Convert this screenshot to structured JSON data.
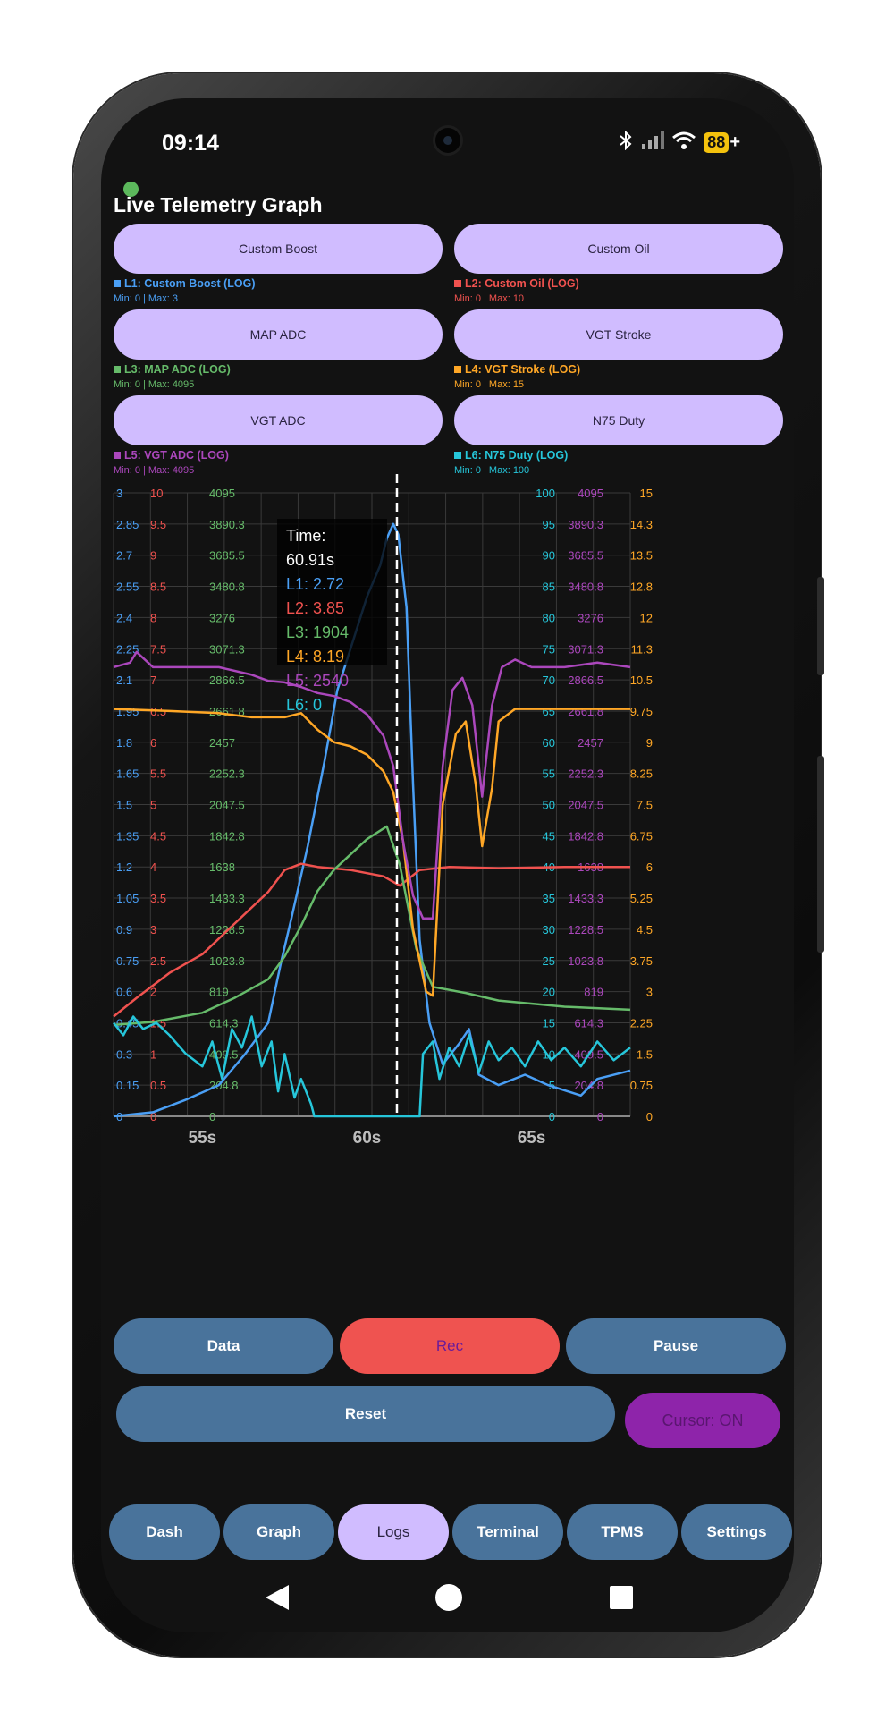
{
  "status_bar": {
    "time": "09:14",
    "battery": "88",
    "icons": [
      "bluetooth-icon",
      "signal-icon",
      "wifi-icon",
      "battery-icon"
    ]
  },
  "app": {
    "title": "Live Telemetry Graph",
    "status_dot_color": "#5cb85c"
  },
  "selectors": [
    {
      "label": "Custom Boost",
      "legend": "L1: Custom Boost (LOG)",
      "range": "Min: 0 | Max: 3",
      "color": "#4a9ff5"
    },
    {
      "label": "Custom Oil",
      "legend": "L2: Custom Oil (LOG)",
      "range": "Min: 0 | Max: 10",
      "color": "#f0524f"
    },
    {
      "label": "MAP ADC",
      "legend": "L3: MAP ADC (LOG)",
      "range": "Min: 0 | Max: 4095",
      "color": "#66bb6a"
    },
    {
      "label": "VGT Stroke",
      "legend": "L4: VGT Stroke (LOG)",
      "range": "Min: 0 | Max: 15",
      "color": "#ffa726"
    },
    {
      "label": "VGT ADC",
      "legend": "L5: VGT ADC (LOG)",
      "range": "Min: 0 | Max: 4095",
      "color": "#ab47bc"
    },
    {
      "label": "N75 Duty",
      "legend": "L6: N75 Duty (LOG)",
      "range": "Min: 0 | Max: 100",
      "color": "#26c6da"
    }
  ],
  "tooltip": {
    "time": "Time: 60.91s",
    "lines": [
      "L1: 2.72",
      "L2: 3.85",
      "L3: 1904",
      "L4: 8.19",
      "L5: 2540",
      "L6: 0"
    ]
  },
  "chart_data": {
    "type": "line",
    "x_unit": "s",
    "xlim": [
      52.3,
      68.0
    ],
    "x_ticks": [
      "55s",
      "60s",
      "65s"
    ],
    "x_tick_values": [
      55,
      60,
      65
    ],
    "cursor_x": 60.91,
    "axes": {
      "L1": [
        "0",
        "0.15",
        "0.3",
        "0.45",
        "0.6",
        "0.75",
        "0.9",
        "1.05",
        "1.2",
        "1.35",
        "1.5",
        "1.65",
        "1.8",
        "1.95",
        "2.1",
        "2.25",
        "2.4",
        "2.55",
        "2.7",
        "2.85",
        "3"
      ],
      "L2": [
        "0",
        "0.5",
        "1",
        "1.5",
        "2",
        "2.5",
        "3",
        "3.5",
        "4",
        "4.5",
        "5",
        "5.5",
        "6",
        "6.5",
        "7",
        "7.5",
        "8",
        "8.5",
        "9",
        "9.5",
        "10"
      ],
      "L3": [
        "0",
        "204.8",
        "409.5",
        "614.3",
        "819",
        "1023.8",
        "1228.5",
        "1433.3",
        "1638",
        "1842.8",
        "2047.5",
        "2252.3",
        "2457",
        "2661.8",
        "2866.5",
        "3071.3",
        "3276",
        "3480.8",
        "3685.5",
        "3890.3",
        "4095"
      ],
      "L6": [
        "0",
        "5",
        "10",
        "15",
        "20",
        "25",
        "30",
        "35",
        "40",
        "45",
        "50",
        "55",
        "60",
        "65",
        "70",
        "75",
        "80",
        "85",
        "90",
        "95",
        "100"
      ],
      "L5": [
        "0",
        "204.8",
        "409.5",
        "614.3",
        "819",
        "1023.8",
        "1228.5",
        "1433.3",
        "1638",
        "1842.8",
        "2047.5",
        "2252.3",
        "2457",
        "2661.8",
        "2866.5",
        "3071.3",
        "3276",
        "3480.8",
        "3685.5",
        "3890.3",
        "4095"
      ],
      "L4": [
        "0",
        "0.75",
        "1.5",
        "2.25",
        "3",
        "3.75",
        "4.5",
        "5.25",
        "6",
        "6.75",
        "7.5",
        "8.25",
        "9",
        "9.75",
        "10.5",
        "11.3",
        "12",
        "12.8",
        "13.5",
        "14.3",
        "15"
      ]
    },
    "series": [
      {
        "name": "L1: Custom Boost (LOG)",
        "color": "#4a9ff5",
        "max": 3,
        "points": [
          [
            52.3,
            0.0
          ],
          [
            53.5,
            0.02
          ],
          [
            54.5,
            0.08
          ],
          [
            55.5,
            0.15
          ],
          [
            56.3,
            0.3
          ],
          [
            57.0,
            0.45
          ],
          [
            57.4,
            0.75
          ],
          [
            57.7,
            0.95
          ],
          [
            58.2,
            1.3
          ],
          [
            58.7,
            1.7
          ],
          [
            59.1,
            2.05
          ],
          [
            59.6,
            2.3
          ],
          [
            60.0,
            2.5
          ],
          [
            60.4,
            2.65
          ],
          [
            60.6,
            2.78
          ],
          [
            60.8,
            2.85
          ],
          [
            60.95,
            2.8
          ],
          [
            61.2,
            2.45
          ],
          [
            61.4,
            1.6
          ],
          [
            61.6,
            0.85
          ],
          [
            61.9,
            0.45
          ],
          [
            62.3,
            0.25
          ],
          [
            62.8,
            0.35
          ],
          [
            63.1,
            0.42
          ],
          [
            63.4,
            0.2
          ],
          [
            64.0,
            0.15
          ],
          [
            64.8,
            0.2
          ],
          [
            65.5,
            0.15
          ],
          [
            66.5,
            0.1
          ],
          [
            67.0,
            0.18
          ],
          [
            68.0,
            0.22
          ]
        ]
      },
      {
        "name": "L2: Custom Oil (LOG)",
        "color": "#f0524f",
        "max": 10,
        "points": [
          [
            52.3,
            1.6
          ],
          [
            53.0,
            1.9
          ],
          [
            54.0,
            2.3
          ],
          [
            55.0,
            2.6
          ],
          [
            56.0,
            3.1
          ],
          [
            57.0,
            3.6
          ],
          [
            57.5,
            3.95
          ],
          [
            58.0,
            4.05
          ],
          [
            58.5,
            4.0
          ],
          [
            59.5,
            3.95
          ],
          [
            60.5,
            3.85
          ],
          [
            61.0,
            3.7
          ],
          [
            61.6,
            3.95
          ],
          [
            62.5,
            4.0
          ],
          [
            64.0,
            3.98
          ],
          [
            66.0,
            4.0
          ],
          [
            68.0,
            4.0
          ]
        ]
      },
      {
        "name": "L3: MAP ADC (LOG)",
        "color": "#66bb6a",
        "max": 4095,
        "points": [
          [
            52.3,
            600
          ],
          [
            53.5,
            620
          ],
          [
            55.0,
            680
          ],
          [
            56.0,
            780
          ],
          [
            57.0,
            900
          ],
          [
            57.5,
            1050
          ],
          [
            58.0,
            1250
          ],
          [
            58.5,
            1480
          ],
          [
            59.0,
            1620
          ],
          [
            59.5,
            1720
          ],
          [
            60.0,
            1820
          ],
          [
            60.6,
            1904
          ],
          [
            61.0,
            1650
          ],
          [
            61.5,
            1100
          ],
          [
            62.0,
            850
          ],
          [
            63.0,
            810
          ],
          [
            64.0,
            760
          ],
          [
            66.0,
            720
          ],
          [
            68.0,
            700
          ]
        ]
      },
      {
        "name": "L4: VGT Stroke (LOG)",
        "color": "#ffa726",
        "max": 15,
        "points": [
          [
            52.3,
            9.8
          ],
          [
            54.0,
            9.75
          ],
          [
            55.5,
            9.7
          ],
          [
            56.5,
            9.6
          ],
          [
            57.5,
            9.6
          ],
          [
            58.0,
            9.7
          ],
          [
            58.5,
            9.3
          ],
          [
            59.0,
            9.0
          ],
          [
            59.5,
            8.9
          ],
          [
            60.0,
            8.7
          ],
          [
            60.5,
            8.3
          ],
          [
            60.8,
            7.8
          ],
          [
            61.1,
            6.6
          ],
          [
            61.4,
            4.5
          ],
          [
            61.8,
            3.0
          ],
          [
            62.0,
            2.9
          ],
          [
            62.3,
            7.5
          ],
          [
            62.7,
            9.2
          ],
          [
            63.0,
            9.5
          ],
          [
            63.3,
            8.0
          ],
          [
            63.5,
            6.5
          ],
          [
            63.8,
            7.9
          ],
          [
            64.0,
            9.5
          ],
          [
            64.5,
            9.8
          ],
          [
            66.0,
            9.8
          ],
          [
            68.0,
            9.8
          ]
        ]
      },
      {
        "name": "L5: VGT ADC (LOG)",
        "color": "#ab47bc",
        "max": 4095,
        "points": [
          [
            52.3,
            2950
          ],
          [
            52.8,
            2980
          ],
          [
            53.0,
            3050
          ],
          [
            53.5,
            2950
          ],
          [
            54.5,
            2950
          ],
          [
            55.5,
            2950
          ],
          [
            56.5,
            2900
          ],
          [
            57.0,
            2860
          ],
          [
            57.5,
            2850
          ],
          [
            58.0,
            2820
          ],
          [
            58.5,
            2780
          ],
          [
            59.0,
            2760
          ],
          [
            59.5,
            2720
          ],
          [
            60.0,
            2640
          ],
          [
            60.5,
            2500
          ],
          [
            60.8,
            2300
          ],
          [
            61.1,
            1800
          ],
          [
            61.4,
            1450
          ],
          [
            61.7,
            1300
          ],
          [
            62.0,
            1300
          ],
          [
            62.3,
            2300
          ],
          [
            62.6,
            2800
          ],
          [
            62.9,
            2880
          ],
          [
            63.2,
            2700
          ],
          [
            63.5,
            2100
          ],
          [
            63.8,
            2700
          ],
          [
            64.1,
            2950
          ],
          [
            64.5,
            3000
          ],
          [
            65.0,
            2950
          ],
          [
            66.0,
            2950
          ],
          [
            67.0,
            2980
          ],
          [
            68.0,
            2950
          ]
        ]
      },
      {
        "name": "L6: N75 Duty (LOG)",
        "color": "#26c6da",
        "max": 100,
        "points": [
          [
            52.3,
            15
          ],
          [
            52.6,
            13
          ],
          [
            52.9,
            16
          ],
          [
            53.2,
            14
          ],
          [
            53.6,
            15
          ],
          [
            54.0,
            13
          ],
          [
            54.5,
            10
          ],
          [
            55.0,
            8
          ],
          [
            55.3,
            12
          ],
          [
            55.6,
            6
          ],
          [
            55.9,
            14
          ],
          [
            56.2,
            11
          ],
          [
            56.5,
            16
          ],
          [
            56.8,
            8
          ],
          [
            57.1,
            12
          ],
          [
            57.3,
            4
          ],
          [
            57.5,
            10
          ],
          [
            57.8,
            3
          ],
          [
            58.0,
            6
          ],
          [
            58.3,
            2
          ],
          [
            58.4,
            0
          ],
          [
            59.0,
            0
          ],
          [
            60.0,
            0
          ],
          [
            61.0,
            0
          ],
          [
            61.6,
            0
          ],
          [
            61.7,
            10
          ],
          [
            62.0,
            12
          ],
          [
            62.2,
            6
          ],
          [
            62.5,
            11
          ],
          [
            62.8,
            8
          ],
          [
            63.1,
            13
          ],
          [
            63.4,
            7
          ],
          [
            63.7,
            12
          ],
          [
            64.0,
            9
          ],
          [
            64.4,
            11
          ],
          [
            64.8,
            8
          ],
          [
            65.2,
            12
          ],
          [
            65.6,
            9
          ],
          [
            66.0,
            11
          ],
          [
            66.5,
            8
          ],
          [
            67.0,
            12
          ],
          [
            67.5,
            9
          ],
          [
            68.0,
            11
          ]
        ]
      }
    ]
  },
  "controls": {
    "data": "Data",
    "rec": "Rec",
    "pause": "Pause",
    "reset": "Reset",
    "cursor": "Cursor: ON"
  },
  "colors": {
    "button_blue": "#49739b",
    "rec_red": "#ef5350",
    "cursor_purple": "#8e24aa",
    "selected_tab": "#d0bcff"
  },
  "nav": {
    "items": [
      "Dash",
      "Graph",
      "Logs",
      "Terminal",
      "TPMS",
      "Settings"
    ],
    "selected": "Logs"
  }
}
